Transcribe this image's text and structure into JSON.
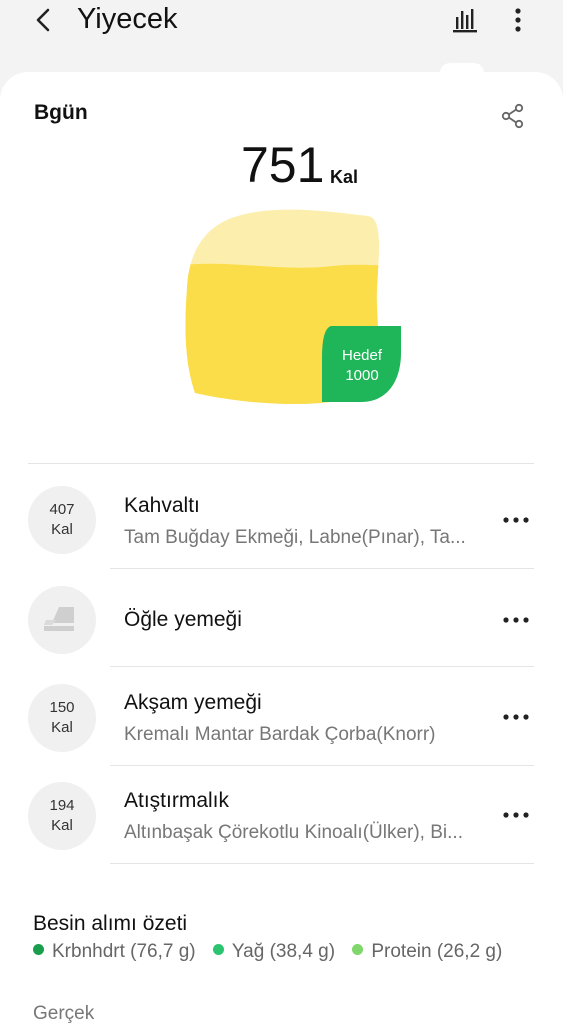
{
  "header": {
    "title": "Yiyecek",
    "back_icon": "chevron-left-icon",
    "stats_icon": "bar-chart-icon",
    "more_icon": "more-vertical-icon"
  },
  "summary_card": {
    "day_label": "Bgün",
    "share_icon": "share-icon",
    "calories": "751",
    "calorie_unit": "Kal",
    "goal_label": "Hedef",
    "goal_value": "1000",
    "progress_fraction": 0.751,
    "colors": {
      "fill": "#fbdc49",
      "fill_light": "#fcefae",
      "goal": "#1fb559"
    }
  },
  "meals": [
    {
      "circle_value": "407",
      "circle_unit": "Kal",
      "name": "Kahvaltı",
      "items": "Tam Buğday Ekmeği, Labne(Pınar), Ta..."
    },
    {
      "icon": "sandwich-icon",
      "name": "Öğle yemeği",
      "items": ""
    },
    {
      "circle_value": "150",
      "circle_unit": "Kal",
      "name": "Akşam yemeği",
      "items": "Kremalı Mantar Bardak Çorba(Knorr)"
    },
    {
      "circle_value": "194",
      "circle_unit": "Kal",
      "name": "Atıştırmalık",
      "items": "Altınbaşak Çörekotlu Kinoalı(Ülker), Bi..."
    }
  ],
  "nutrition": {
    "title": "Besin alımı özeti",
    "legend": [
      {
        "label": "Krbnhdrt (76,7 g)",
        "color": "#1a9e4e"
      },
      {
        "label": "Yağ (38,4 g)",
        "color": "#2cc46e"
      },
      {
        "label": "Protein (26,2 g)",
        "color": "#7fd66a"
      }
    ],
    "actual_label": "Gerçek"
  }
}
